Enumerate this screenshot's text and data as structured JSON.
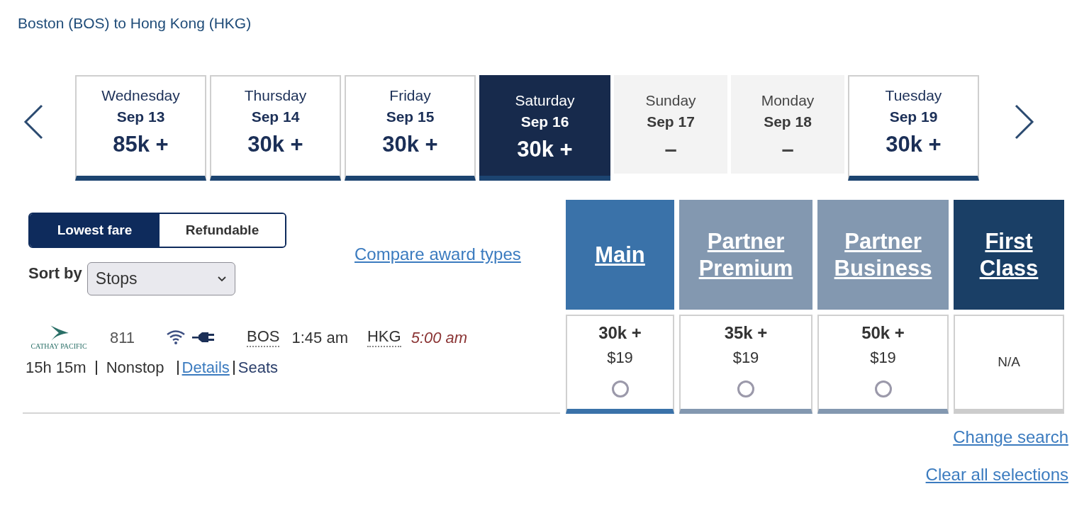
{
  "title": "Boston (BOS) to Hong Kong (HKG)",
  "date_carousel": {
    "days": [
      {
        "weekday": "Wednesday",
        "date": "Sep 13",
        "fare": "85k +",
        "available": true,
        "selected": false
      },
      {
        "weekday": "Thursday",
        "date": "Sep 14",
        "fare": "30k +",
        "available": true,
        "selected": false
      },
      {
        "weekday": "Friday",
        "date": "Sep 15",
        "fare": "30k +",
        "available": true,
        "selected": false
      },
      {
        "weekday": "Saturday",
        "date": "Sep 16",
        "fare": "30k +",
        "available": true,
        "selected": true
      },
      {
        "weekday": "Sunday",
        "date": "Sep 17",
        "fare": "–",
        "available": false,
        "selected": false
      },
      {
        "weekday": "Monday",
        "date": "Sep 18",
        "fare": "–",
        "available": false,
        "selected": false
      },
      {
        "weekday": "Tuesday",
        "date": "Sep 19",
        "fare": "30k +",
        "available": true,
        "selected": false
      }
    ]
  },
  "fare_filter": {
    "options": [
      {
        "label": "Lowest fare",
        "selected": true
      },
      {
        "label": "Refundable",
        "selected": false
      }
    ]
  },
  "sort": {
    "label": "Sort by",
    "value": "Stops"
  },
  "compare_link": "Compare award types",
  "fare_classes": [
    {
      "name": "Main",
      "color": "#3a72a9"
    },
    {
      "name": "Partner Premium",
      "color": "#8398b0"
    },
    {
      "name": "Partner Business",
      "color": "#8398b0"
    },
    {
      "name": "First Class",
      "color": "#1a3f66"
    }
  ],
  "flights": [
    {
      "airline_logo_text": "CATHAY PACIFIC",
      "flight_number": "811",
      "origin": "BOS",
      "departure": "1:45 am",
      "destination": "HKG",
      "arrival": "5:00 am",
      "duration": "15h 15m",
      "stops": "Nonstop",
      "details_link": "Details",
      "seats_link": "Seats",
      "fares": [
        {
          "kind": "price",
          "miles": "30k +",
          "taxes": "$19",
          "selected": false
        },
        {
          "kind": "price",
          "miles": "35k +",
          "taxes": "$19",
          "selected": false
        },
        {
          "kind": "price",
          "miles": "50k +",
          "taxes": "$19",
          "selected": false
        },
        {
          "kind": "unavailable",
          "note": "N/A"
        }
      ]
    }
  ],
  "links": [
    "Change search",
    "Clear all selections"
  ]
}
